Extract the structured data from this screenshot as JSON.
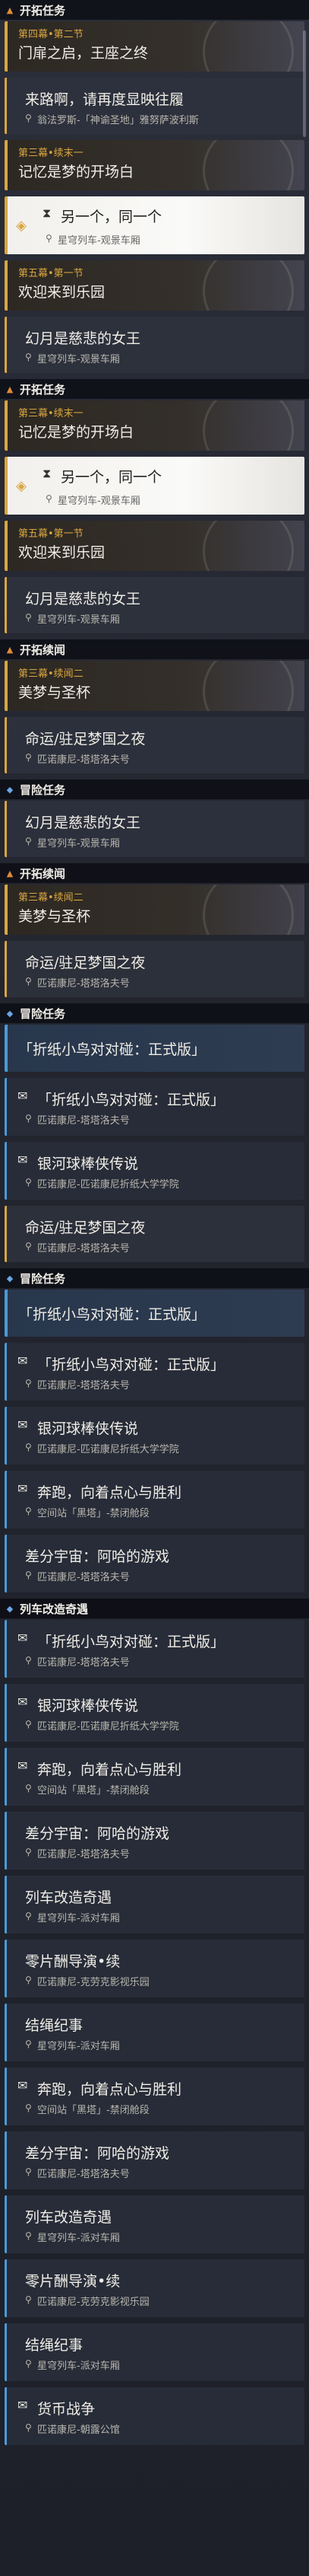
{
  "sections": [
    {
      "type": "header",
      "icon": "pin",
      "label": "开拓任务"
    },
    {
      "type": "main",
      "chapter": "第四幕•第二节",
      "title": "门扉之启，王座之终"
    },
    {
      "type": "sub",
      "title": "来路啊，请再度显映往履",
      "loc": "翁法罗斯-「神谕圣地」雅努萨波利斯"
    },
    {
      "type": "main",
      "chapter": "第三幕•续末一",
      "title": "记忆是梦的开场白"
    },
    {
      "type": "selected",
      "title": "另一个，同一个",
      "loc": "星穹列车-观景车厢"
    },
    {
      "type": "main",
      "chapter": "第五幕•第一节",
      "title": "欢迎来到乐园"
    },
    {
      "type": "sub",
      "title": "幻月是慈悲的女王",
      "loc": "星穹列车-观景车厢"
    },
    {
      "type": "header",
      "icon": "pin",
      "label": "开拓任务"
    },
    {
      "type": "main",
      "chapter": "第三幕•续末一",
      "title": "记忆是梦的开场白"
    },
    {
      "type": "selected",
      "title": "另一个，同一个",
      "loc": "星穹列车-观景车厢"
    },
    {
      "type": "main",
      "chapter": "第五幕•第一节",
      "title": "欢迎来到乐园"
    },
    {
      "type": "sub",
      "title": "幻月是慈悲的女王",
      "loc": "星穹列车-观景车厢"
    },
    {
      "type": "header",
      "icon": "pin",
      "label": "开拓续闻"
    },
    {
      "type": "main",
      "chapter": "第三幕•续闻二",
      "title": "美梦与圣杯"
    },
    {
      "type": "sub",
      "title": "命运/驻足梦国之夜",
      "loc": "匹诺康尼-塔塔洛夫号"
    },
    {
      "type": "header",
      "icon": "adv",
      "label": "冒险任务"
    },
    {
      "type": "sub",
      "title": "幻月是慈悲的女王",
      "loc": "星穹列车-观景车厢"
    },
    {
      "type": "header",
      "icon": "pin",
      "label": "开拓续闻"
    },
    {
      "type": "main",
      "chapter": "第三幕•续闻二",
      "title": "美梦与圣杯"
    },
    {
      "type": "sub",
      "title": "命运/驻足梦国之夜",
      "loc": "匹诺康尼-塔塔洛夫号"
    },
    {
      "type": "header",
      "icon": "adv",
      "label": "冒险任务"
    },
    {
      "type": "blueBig",
      "title": "「折纸小鸟对对碰：正式版」"
    },
    {
      "type": "blue",
      "title": "「折纸小鸟对对碰：正式版」",
      "loc": "匹诺康尼-塔塔洛夫号",
      "icon": "bird"
    },
    {
      "type": "blue",
      "title": "银河球棒侠传说",
      "loc": "匹诺康尼-匹诺康尼折纸大学学院",
      "icon": "bird"
    },
    {
      "type": "sub",
      "title": "命运/驻足梦国之夜",
      "loc": "匹诺康尼-塔塔洛夫号"
    },
    {
      "type": "header",
      "icon": "adv",
      "label": "冒险任务"
    },
    {
      "type": "blueBig",
      "title": "「折纸小鸟对对碰：正式版」"
    },
    {
      "type": "blue",
      "title": "「折纸小鸟对对碰：正式版」",
      "loc": "匹诺康尼-塔塔洛夫号",
      "icon": "bird"
    },
    {
      "type": "blue",
      "title": "银河球棒侠传说",
      "loc": "匹诺康尼-匹诺康尼折纸大学学院",
      "icon": "bird"
    },
    {
      "type": "blue",
      "title": "奔跑，向着点心与胜利",
      "loc": "空间站「黑塔」-禁闭舱段",
      "icon": "bird"
    },
    {
      "type": "blue",
      "title": "差分宇宙：阿哈的游戏",
      "loc": "匹诺康尼-塔塔洛夫号"
    },
    {
      "type": "header",
      "icon": "adv",
      "label": "列车改造奇遇"
    },
    {
      "type": "blue",
      "title": "「折纸小鸟对对碰：正式版」",
      "loc": "匹诺康尼-塔塔洛夫号",
      "icon": "bird"
    },
    {
      "type": "blue",
      "title": "银河球棒侠传说",
      "loc": "匹诺康尼-匹诺康尼折纸大学学院",
      "icon": "bird"
    },
    {
      "type": "blue",
      "title": "奔跑，向着点心与胜利",
      "loc": "空间站「黑塔」-禁闭舱段",
      "icon": "bird"
    },
    {
      "type": "blue",
      "title": "差分宇宙：阿哈的游戏",
      "loc": "匹诺康尼-塔塔洛夫号"
    },
    {
      "type": "blue",
      "title": "列车改造奇遇",
      "loc": "星穹列车-派对车厢"
    },
    {
      "type": "blue",
      "title": "零片酬导演•续",
      "loc": "匹诺康尼-克劳克影视乐园"
    },
    {
      "type": "blue",
      "title": "结绳纪事",
      "loc": "星穹列车-派对车厢"
    },
    {
      "type": "blue",
      "title": "奔跑，向着点心与胜利",
      "loc": "空间站「黑塔」-禁闭舱段",
      "icon": "bird"
    },
    {
      "type": "blue",
      "title": "差分宇宙：阿哈的游戏",
      "loc": "匹诺康尼-塔塔洛夫号"
    },
    {
      "type": "blue",
      "title": "列车改造奇遇",
      "loc": "星穹列车-派对车厢"
    },
    {
      "type": "blue",
      "title": "零片酬导演•续",
      "loc": "匹诺康尼-克劳克影视乐园"
    },
    {
      "type": "blue",
      "title": "结绳纪事",
      "loc": "星穹列车-派对车厢"
    },
    {
      "type": "blue",
      "title": "货币战争",
      "loc": "匹诺康尼-朝露公馆",
      "icon": "bird"
    }
  ]
}
